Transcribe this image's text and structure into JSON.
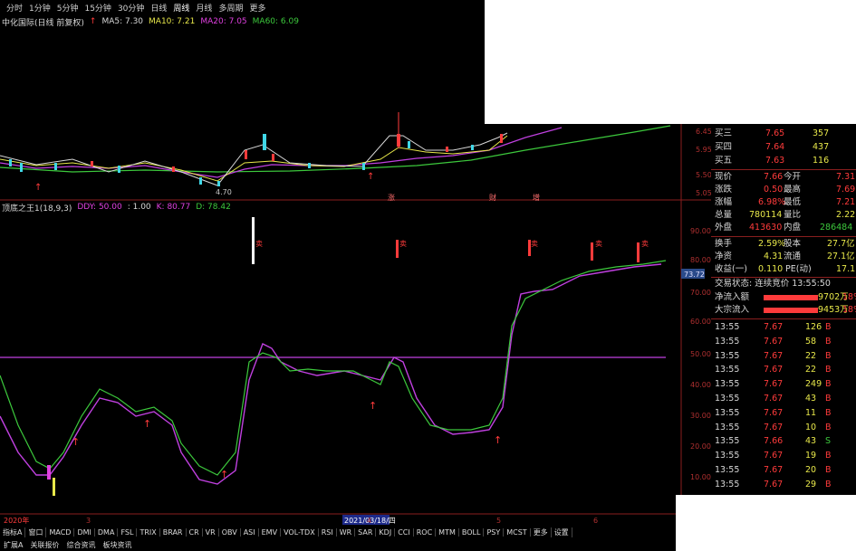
{
  "period_tabs": [
    "分时",
    "1分钟",
    "5分钟",
    "15分钟",
    "30分钟",
    "日线",
    "周线",
    "月线",
    "多周期",
    "更多"
  ],
  "stock_title": "中化国际(日线 前复权)",
  "ma_legend": {
    "ma5": "MA5: 7.30",
    "ma10": "MA10: 7.21",
    "ma20": "MA20: 7.05",
    "ma60": "MA60: 6.09"
  },
  "indicator_legend": {
    "name": "顶底之王1(18,9,3)",
    "ddy": "DDY: 50.00",
    "v1": ": 1.00",
    "k": "K: 80.77",
    "d": "D: 78.42"
  },
  "candle_axis": [
    "6.45",
    "5.95",
    "5.50",
    "5.05"
  ],
  "candle_low_label": "4.70",
  "event_labels": [
    "涨",
    "财",
    "增"
  ],
  "indicator_axis": [
    "90.00",
    "80.00",
    "70.00",
    "60.00",
    "50.00",
    "40.00",
    "30.00",
    "20.00",
    "10.00"
  ],
  "current_k": "73.72",
  "sell_mark": "卖",
  "x_axis": {
    "start": "2020年",
    "date": "2021/03/18/四",
    "labels": [
      "3",
      "4",
      "5",
      "6"
    ]
  },
  "quote": {
    "bids": [
      {
        "label": "买三",
        "price": "7.65",
        "vol": "357"
      },
      {
        "label": "买四",
        "price": "7.64",
        "vol": "437"
      },
      {
        "label": "买五",
        "price": "7.63",
        "vol": "116"
      }
    ],
    "stats": [
      {
        "l1": "现价",
        "v1": "7.66",
        "l2": "今开",
        "v2": "7.31"
      },
      {
        "l1": "涨跌",
        "v1": "0.50",
        "l2": "最高",
        "v2": "7.69"
      },
      {
        "l1": "涨幅",
        "v1": "6.98%",
        "l2": "最低",
        "v2": "7.21"
      },
      {
        "l1": "总量",
        "v1": "780114",
        "l2": "量比",
        "v2": "2.22"
      },
      {
        "l1": "外盘",
        "v1": "413630",
        "l2": "内盘",
        "v2": "286484"
      }
    ],
    "stats2": [
      {
        "l1": "换手",
        "v1": "2.59%",
        "l2": "股本",
        "v2": "27.7亿"
      },
      {
        "l1": "净资",
        "v1": "4.31",
        "l2": "流通",
        "v2": "27.1亿"
      },
      {
        "l1": "收益(一)",
        "v1": "0.110",
        "l2": "PE(动)",
        "v2": "17.1"
      }
    ],
    "trade_status": "交易状态: 连续竞价 13:55:50",
    "flows": [
      {
        "label": "净流入额",
        "value": "9702万",
        "pct": "18%"
      },
      {
        "label": "大宗流入",
        "value": "9453万",
        "pct": "18%"
      }
    ],
    "ticks": [
      {
        "t": "13:55",
        "p": "7.67",
        "v": "126",
        "f": "B"
      },
      {
        "t": "13:55",
        "p": "7.67",
        "v": "58",
        "f": "B"
      },
      {
        "t": "13:55",
        "p": "7.67",
        "v": "22",
        "f": "B"
      },
      {
        "t": "13:55",
        "p": "7.67",
        "v": "22",
        "f": "B"
      },
      {
        "t": "13:55",
        "p": "7.67",
        "v": "249",
        "f": "B"
      },
      {
        "t": "13:55",
        "p": "7.67",
        "v": "43",
        "f": "B"
      },
      {
        "t": "13:55",
        "p": "7.67",
        "v": "11",
        "f": "B"
      },
      {
        "t": "13:55",
        "p": "7.67",
        "v": "10",
        "f": "B"
      },
      {
        "t": "13:55",
        "p": "7.66",
        "v": "43",
        "f": "S"
      },
      {
        "t": "13:55",
        "p": "7.67",
        "v": "19",
        "f": "B"
      },
      {
        "t": "13:55",
        "p": "7.67",
        "v": "20",
        "f": "B"
      },
      {
        "t": "13:55",
        "p": "7.67",
        "v": "29",
        "f": "B"
      },
      {
        "t": "13:55",
        "p": "7.67",
        "v": "37",
        "f": "S"
      },
      {
        "t": "13:55",
        "p": "7.66",
        "v": "14",
        "f": "S"
      }
    ]
  },
  "bottom_tabs": [
    "指标A",
    "窗口",
    "MACD",
    "DMI",
    "DMA",
    "FSL",
    "TRIX",
    "BRAR",
    "CR",
    "VR",
    "OBV",
    "ASI",
    "EMV",
    "VOL-TDX",
    "RSI",
    "WR",
    "SAR",
    "KDJ",
    "CCI",
    "ROC",
    "MTM",
    "BOLL",
    "PSY",
    "MCST",
    "更多",
    "设置"
  ],
  "bottom_tabs_right": [
    "指标B",
    "模板"
  ],
  "bottom_tabs2": [
    "扩展A",
    "关联报价",
    "综合资讯",
    "板块资讯"
  ],
  "corner_label": "图文F10",
  "colors": {
    "red": "#ff3b3b",
    "green": "#3cc83c",
    "magenta": "#c040e0",
    "cyan": "#40d8e8",
    "grid": "#8a1e1e"
  }
}
